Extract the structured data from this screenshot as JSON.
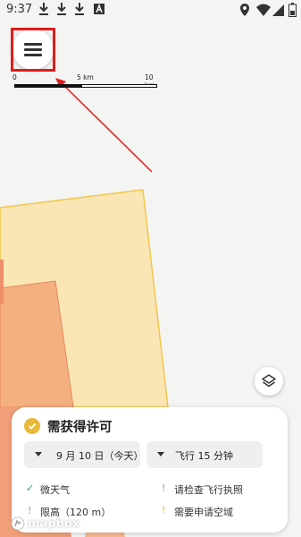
{
  "status_bar": {
    "time": "9:37",
    "notification_icons": [
      "download-icon",
      "download-icon",
      "download-icon",
      "app-a-icon"
    ],
    "right_icons": [
      "location-icon",
      "wifi-icon",
      "signal-icon",
      "battery-icon"
    ]
  },
  "map": {
    "scale": {
      "label_zero": "0",
      "label_mid": "5 km",
      "label_end": "10 km"
    },
    "zone_colors": {
      "outer": "#fae6b4",
      "outer_border": "#f2c64b",
      "inner": "#f5b07f",
      "inner_border": "#e8855a"
    }
  },
  "annotation": {
    "highlight_color": "#e31b1b"
  },
  "panel": {
    "title": "需获得许可",
    "status_color": "#e8b93a",
    "date_chip": "9 月 10 日（今天）",
    "duration_chip": "飞行 15 分钟",
    "rows": [
      {
        "left": "微天气",
        "left_mark": "✓",
        "right": "请检查飞行执照",
        "right_mark": "!"
      },
      {
        "left": "限高（120 m）",
        "left_mark": "!",
        "right": "需要申请空域",
        "right_mark": "!"
      }
    ]
  },
  "logo": {
    "text": "mapbox"
  }
}
